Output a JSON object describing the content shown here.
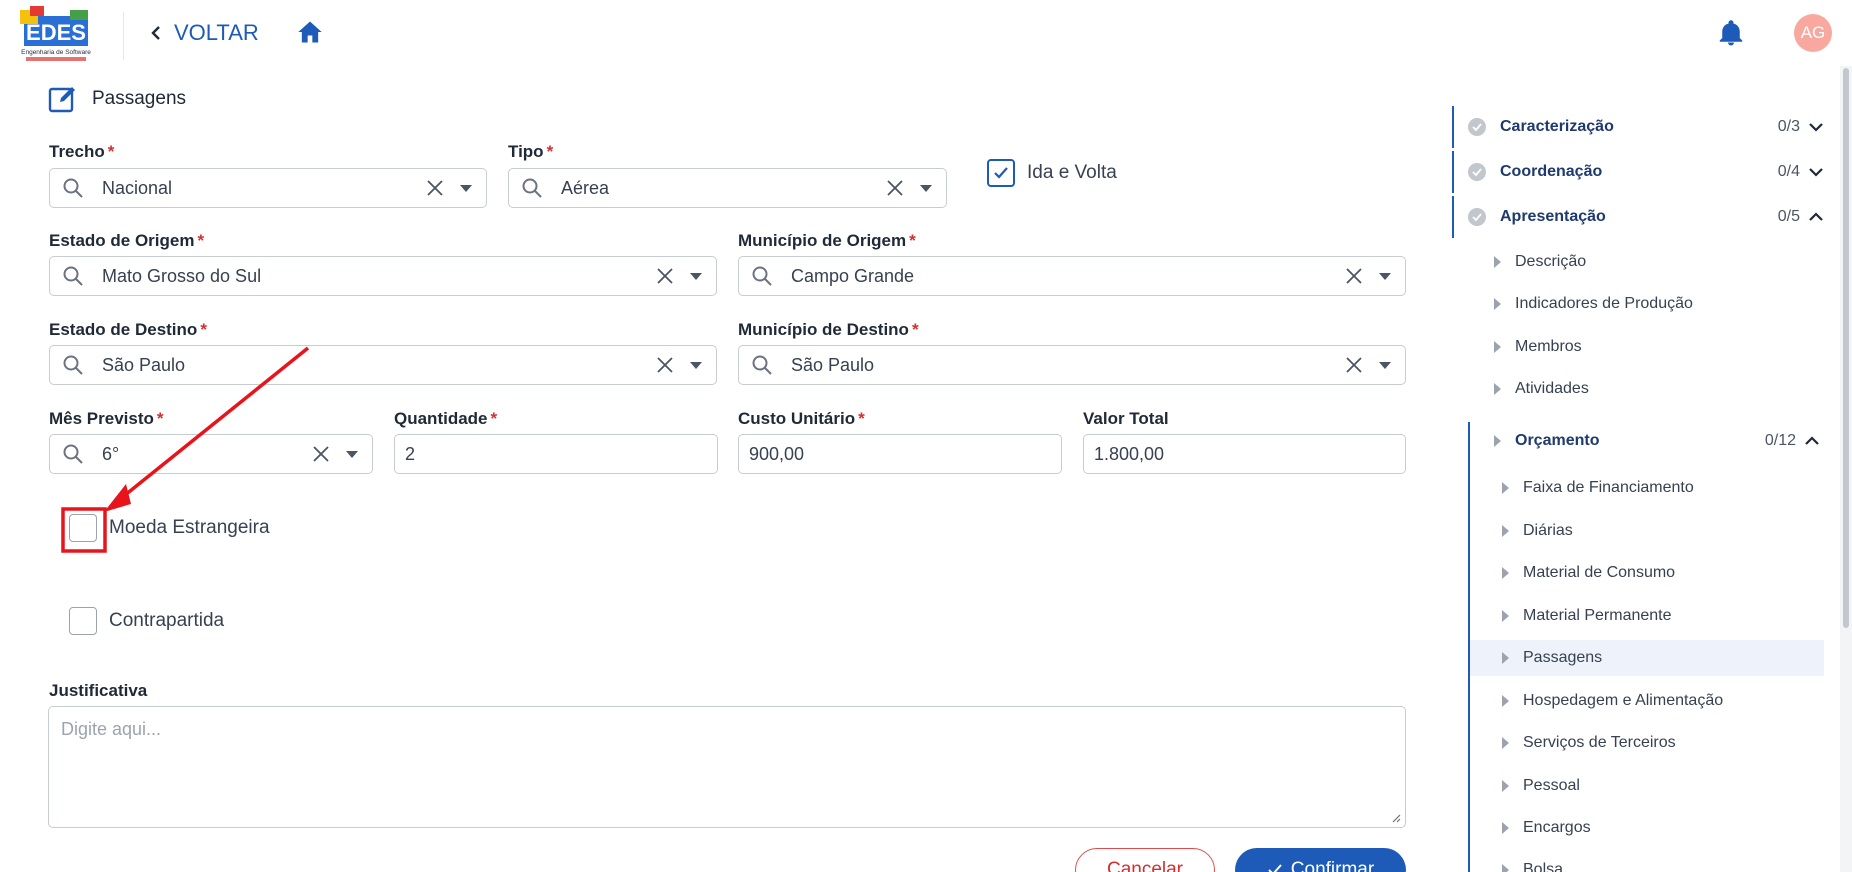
{
  "header": {
    "logo_text": "EDES",
    "logo_subtext": "Engenharia de Software",
    "back_label": "VOLTAR",
    "avatar_initials": "AG"
  },
  "section": {
    "title": "Passagens"
  },
  "form": {
    "trecho": {
      "label": "Trecho",
      "value": "Nacional"
    },
    "tipo": {
      "label": "Tipo",
      "value": "Aérea"
    },
    "ida_volta": {
      "label": "Ida e Volta",
      "checked": true
    },
    "estado_origem": {
      "label": "Estado de Origem",
      "value": "Mato Grosso do Sul"
    },
    "municipio_origem": {
      "label": "Município de Origem",
      "value": "Campo Grande"
    },
    "estado_destino": {
      "label": "Estado de Destino",
      "value": "São Paulo"
    },
    "municipio_destino": {
      "label": "Município de Destino",
      "value": "São Paulo"
    },
    "mes_previsto": {
      "label": "Mês Previsto",
      "value": "6°"
    },
    "quantidade": {
      "label": "Quantidade",
      "value": "2"
    },
    "custo_unitario": {
      "label": "Custo Unitário",
      "value": "900,00"
    },
    "valor_total": {
      "label": "Valor Total",
      "value": "1.800,00"
    },
    "moeda_estrangeira": {
      "label": "Moeda Estrangeira",
      "checked": false
    },
    "contrapartida": {
      "label": "Contrapartida",
      "checked": false
    },
    "justificativa": {
      "label": "Justificativa",
      "placeholder": "Digite aqui..."
    },
    "required_mark": "*",
    "cancel_label": "Cancelar",
    "confirm_label": "Confirmar"
  },
  "sidenav": {
    "groups": [
      {
        "label": "Caracterização",
        "count": "0/3",
        "expanded": false
      },
      {
        "label": "Coordenação",
        "count": "0/4",
        "expanded": false
      },
      {
        "label": "Apresentação",
        "count": "0/5",
        "expanded": true
      }
    ],
    "apresentacao_items": [
      {
        "label": "Descrição"
      },
      {
        "label": "Indicadores de Produção"
      },
      {
        "label": "Membros"
      },
      {
        "label": "Atividades"
      }
    ],
    "orcamento": {
      "label": "Orçamento",
      "count": "0/12"
    },
    "orcamento_items": [
      {
        "label": "Faixa de Financiamento"
      },
      {
        "label": "Diárias"
      },
      {
        "label": "Material de Consumo"
      },
      {
        "label": "Material Permanente"
      },
      {
        "label": "Passagens",
        "active": true
      },
      {
        "label": "Hospedagem e Alimentação"
      },
      {
        "label": "Serviços de Terceiros"
      },
      {
        "label": "Pessoal"
      },
      {
        "label": "Encargos"
      },
      {
        "label": "Bolsa"
      }
    ]
  },
  "colors": {
    "primary": "#1e5bb8",
    "required": "#d32f2f",
    "annotation": "#e8141b",
    "avatar": "#f9a8a0"
  }
}
